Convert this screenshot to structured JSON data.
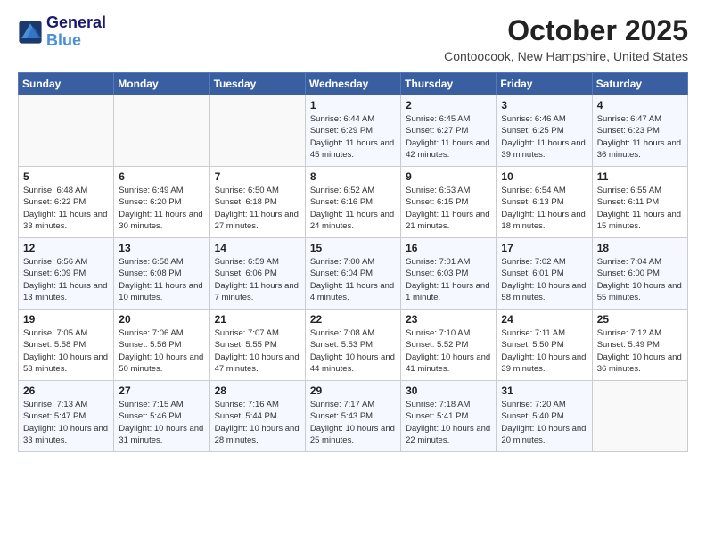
{
  "header": {
    "logo_line1": "General",
    "logo_line2": "Blue",
    "month": "October 2025",
    "location": "Contoocook, New Hampshire, United States"
  },
  "days_of_week": [
    "Sunday",
    "Monday",
    "Tuesday",
    "Wednesday",
    "Thursday",
    "Friday",
    "Saturday"
  ],
  "weeks": [
    [
      {
        "day": "",
        "info": ""
      },
      {
        "day": "",
        "info": ""
      },
      {
        "day": "",
        "info": ""
      },
      {
        "day": "1",
        "info": "Sunrise: 6:44 AM\nSunset: 6:29 PM\nDaylight: 11 hours and 45 minutes."
      },
      {
        "day": "2",
        "info": "Sunrise: 6:45 AM\nSunset: 6:27 PM\nDaylight: 11 hours and 42 minutes."
      },
      {
        "day": "3",
        "info": "Sunrise: 6:46 AM\nSunset: 6:25 PM\nDaylight: 11 hours and 39 minutes."
      },
      {
        "day": "4",
        "info": "Sunrise: 6:47 AM\nSunset: 6:23 PM\nDaylight: 11 hours and 36 minutes."
      }
    ],
    [
      {
        "day": "5",
        "info": "Sunrise: 6:48 AM\nSunset: 6:22 PM\nDaylight: 11 hours and 33 minutes."
      },
      {
        "day": "6",
        "info": "Sunrise: 6:49 AM\nSunset: 6:20 PM\nDaylight: 11 hours and 30 minutes."
      },
      {
        "day": "7",
        "info": "Sunrise: 6:50 AM\nSunset: 6:18 PM\nDaylight: 11 hours and 27 minutes."
      },
      {
        "day": "8",
        "info": "Sunrise: 6:52 AM\nSunset: 6:16 PM\nDaylight: 11 hours and 24 minutes."
      },
      {
        "day": "9",
        "info": "Sunrise: 6:53 AM\nSunset: 6:15 PM\nDaylight: 11 hours and 21 minutes."
      },
      {
        "day": "10",
        "info": "Sunrise: 6:54 AM\nSunset: 6:13 PM\nDaylight: 11 hours and 18 minutes."
      },
      {
        "day": "11",
        "info": "Sunrise: 6:55 AM\nSunset: 6:11 PM\nDaylight: 11 hours and 15 minutes."
      }
    ],
    [
      {
        "day": "12",
        "info": "Sunrise: 6:56 AM\nSunset: 6:09 PM\nDaylight: 11 hours and 13 minutes."
      },
      {
        "day": "13",
        "info": "Sunrise: 6:58 AM\nSunset: 6:08 PM\nDaylight: 11 hours and 10 minutes."
      },
      {
        "day": "14",
        "info": "Sunrise: 6:59 AM\nSunset: 6:06 PM\nDaylight: 11 hours and 7 minutes."
      },
      {
        "day": "15",
        "info": "Sunrise: 7:00 AM\nSunset: 6:04 PM\nDaylight: 11 hours and 4 minutes."
      },
      {
        "day": "16",
        "info": "Sunrise: 7:01 AM\nSunset: 6:03 PM\nDaylight: 11 hours and 1 minute."
      },
      {
        "day": "17",
        "info": "Sunrise: 7:02 AM\nSunset: 6:01 PM\nDaylight: 10 hours and 58 minutes."
      },
      {
        "day": "18",
        "info": "Sunrise: 7:04 AM\nSunset: 6:00 PM\nDaylight: 10 hours and 55 minutes."
      }
    ],
    [
      {
        "day": "19",
        "info": "Sunrise: 7:05 AM\nSunset: 5:58 PM\nDaylight: 10 hours and 53 minutes."
      },
      {
        "day": "20",
        "info": "Sunrise: 7:06 AM\nSunset: 5:56 PM\nDaylight: 10 hours and 50 minutes."
      },
      {
        "day": "21",
        "info": "Sunrise: 7:07 AM\nSunset: 5:55 PM\nDaylight: 10 hours and 47 minutes."
      },
      {
        "day": "22",
        "info": "Sunrise: 7:08 AM\nSunset: 5:53 PM\nDaylight: 10 hours and 44 minutes."
      },
      {
        "day": "23",
        "info": "Sunrise: 7:10 AM\nSunset: 5:52 PM\nDaylight: 10 hours and 41 minutes."
      },
      {
        "day": "24",
        "info": "Sunrise: 7:11 AM\nSunset: 5:50 PM\nDaylight: 10 hours and 39 minutes."
      },
      {
        "day": "25",
        "info": "Sunrise: 7:12 AM\nSunset: 5:49 PM\nDaylight: 10 hours and 36 minutes."
      }
    ],
    [
      {
        "day": "26",
        "info": "Sunrise: 7:13 AM\nSunset: 5:47 PM\nDaylight: 10 hours and 33 minutes."
      },
      {
        "day": "27",
        "info": "Sunrise: 7:15 AM\nSunset: 5:46 PM\nDaylight: 10 hours and 31 minutes."
      },
      {
        "day": "28",
        "info": "Sunrise: 7:16 AM\nSunset: 5:44 PM\nDaylight: 10 hours and 28 minutes."
      },
      {
        "day": "29",
        "info": "Sunrise: 7:17 AM\nSunset: 5:43 PM\nDaylight: 10 hours and 25 minutes."
      },
      {
        "day": "30",
        "info": "Sunrise: 7:18 AM\nSunset: 5:41 PM\nDaylight: 10 hours and 22 minutes."
      },
      {
        "day": "31",
        "info": "Sunrise: 7:20 AM\nSunset: 5:40 PM\nDaylight: 10 hours and 20 minutes."
      },
      {
        "day": "",
        "info": ""
      }
    ]
  ]
}
